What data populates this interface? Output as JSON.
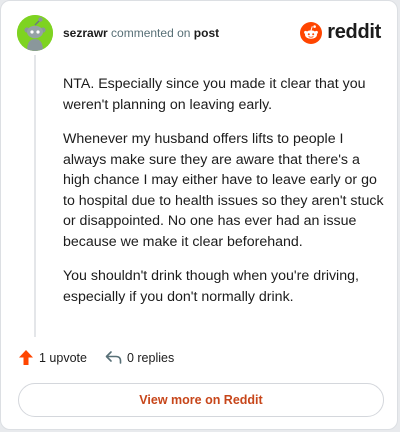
{
  "comment": {
    "username": "sezrawr",
    "action_text": "commented on",
    "post_link": "post",
    "paragraphs": [
      "NTA. Especially since you made it clear that you weren't planning on leaving early.",
      "Whenever my husband offers lifts to people I always make sure they are aware that there's a high chance I may either have to leave early or go to hospital due to health issues so they aren't stuck or disappointed. No one has ever had an issue because we make it clear beforehand.",
      "You shouldn't drink though when you're driving, especially if you don't normally drink."
    ]
  },
  "brand": {
    "logo_text": "reddit",
    "accent_color": "#ff4500"
  },
  "actions": {
    "upvote_label": "1 upvote",
    "replies_label": "0 replies"
  },
  "footer": {
    "view_more_label": "View more on Reddit"
  },
  "icons": {
    "avatar": "snoo-avatar-icon",
    "logo": "reddit-logo-icon",
    "upvote": "upvote-arrow-icon",
    "reply": "reply-arrow-icon"
  }
}
